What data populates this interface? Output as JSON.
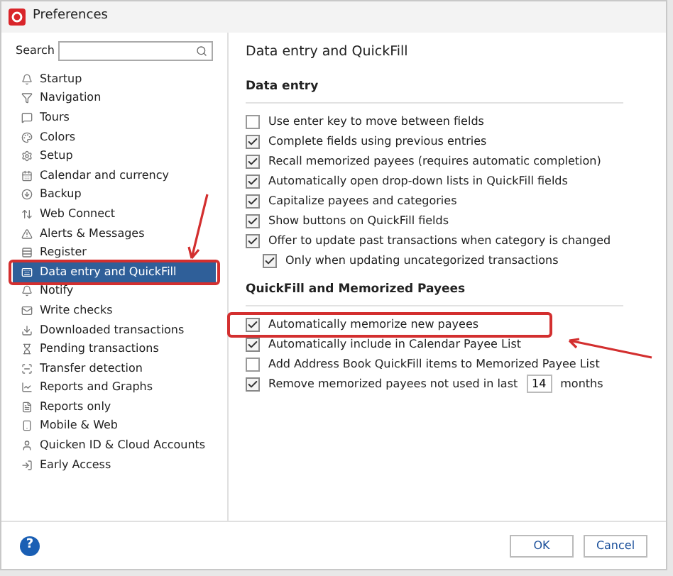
{
  "window": {
    "title": "Preferences"
  },
  "search": {
    "label": "Search"
  },
  "sidebar": {
    "items": [
      {
        "label": "Startup",
        "selected": false,
        "highlighted": false
      },
      {
        "label": "Navigation",
        "selected": false,
        "highlighted": false
      },
      {
        "label": "Tours",
        "selected": false,
        "highlighted": false
      },
      {
        "label": "Colors",
        "selected": false,
        "highlighted": false
      },
      {
        "label": "Setup",
        "selected": false,
        "highlighted": false
      },
      {
        "label": "Calendar and currency",
        "selected": false,
        "highlighted": false
      },
      {
        "label": "Backup",
        "selected": false,
        "highlighted": false
      },
      {
        "label": "Web Connect",
        "selected": false,
        "highlighted": false
      },
      {
        "label": "Alerts & Messages",
        "selected": false,
        "highlighted": false
      },
      {
        "label": "Register",
        "selected": false,
        "highlighted": false
      },
      {
        "label": "Data entry and QuickFill",
        "selected": true,
        "highlighted": true
      },
      {
        "label": "Notify",
        "selected": false,
        "highlighted": false
      },
      {
        "label": "Write checks",
        "selected": false,
        "highlighted": false
      },
      {
        "label": "Downloaded transactions",
        "selected": false,
        "highlighted": false
      },
      {
        "label": "Pending transactions",
        "selected": false,
        "highlighted": false
      },
      {
        "label": "Transfer detection",
        "selected": false,
        "highlighted": false
      },
      {
        "label": "Reports and Graphs",
        "selected": false,
        "highlighted": false
      },
      {
        "label": "Reports only",
        "selected": false,
        "highlighted": false
      },
      {
        "label": "Mobile & Web",
        "selected": false,
        "highlighted": false
      },
      {
        "label": "Quicken ID & Cloud Accounts",
        "selected": false,
        "highlighted": false
      },
      {
        "label": "Early Access",
        "selected": false,
        "highlighted": false
      }
    ]
  },
  "panel": {
    "title": "Data entry and QuickFill",
    "sections": [
      {
        "heading": "Data entry",
        "options": [
          {
            "label": "Use enter key to move between fields",
            "checked": false,
            "highlighted": false
          },
          {
            "label": "Complete fields using previous entries",
            "checked": true,
            "highlighted": false
          },
          {
            "label": "Recall memorized payees (requires automatic completion)",
            "checked": true,
            "highlighted": false
          },
          {
            "label": "Automatically open drop-down lists in QuickFill fields",
            "checked": true,
            "highlighted": false
          },
          {
            "label": "Capitalize payees and categories",
            "checked": true,
            "highlighted": false
          },
          {
            "label": "Show buttons on QuickFill fields",
            "checked": true,
            "highlighted": false
          },
          {
            "label": "Offer to update past transactions when category is changed",
            "checked": true,
            "highlighted": false,
            "children": [
              {
                "label": "Only when updating uncategorized transactions",
                "checked": true,
                "highlighted": false
              }
            ]
          }
        ]
      },
      {
        "heading": "QuickFill and Memorized Payees",
        "options": [
          {
            "label": "Automatically memorize new payees",
            "checked": true,
            "highlighted": true
          },
          {
            "label": "Automatically include in Calendar Payee List",
            "checked": true,
            "highlighted": false
          },
          {
            "label": "Add Address Book QuickFill items to Memorized Payee List",
            "checked": false,
            "highlighted": false
          },
          {
            "label": "Remove memorized payees not used in last",
            "checked": true,
            "highlighted": false,
            "value": "14",
            "suffix": "months"
          }
        ]
      }
    ]
  },
  "footer": {
    "help": "?",
    "buttons": [
      "OK",
      "Cancel"
    ]
  }
}
